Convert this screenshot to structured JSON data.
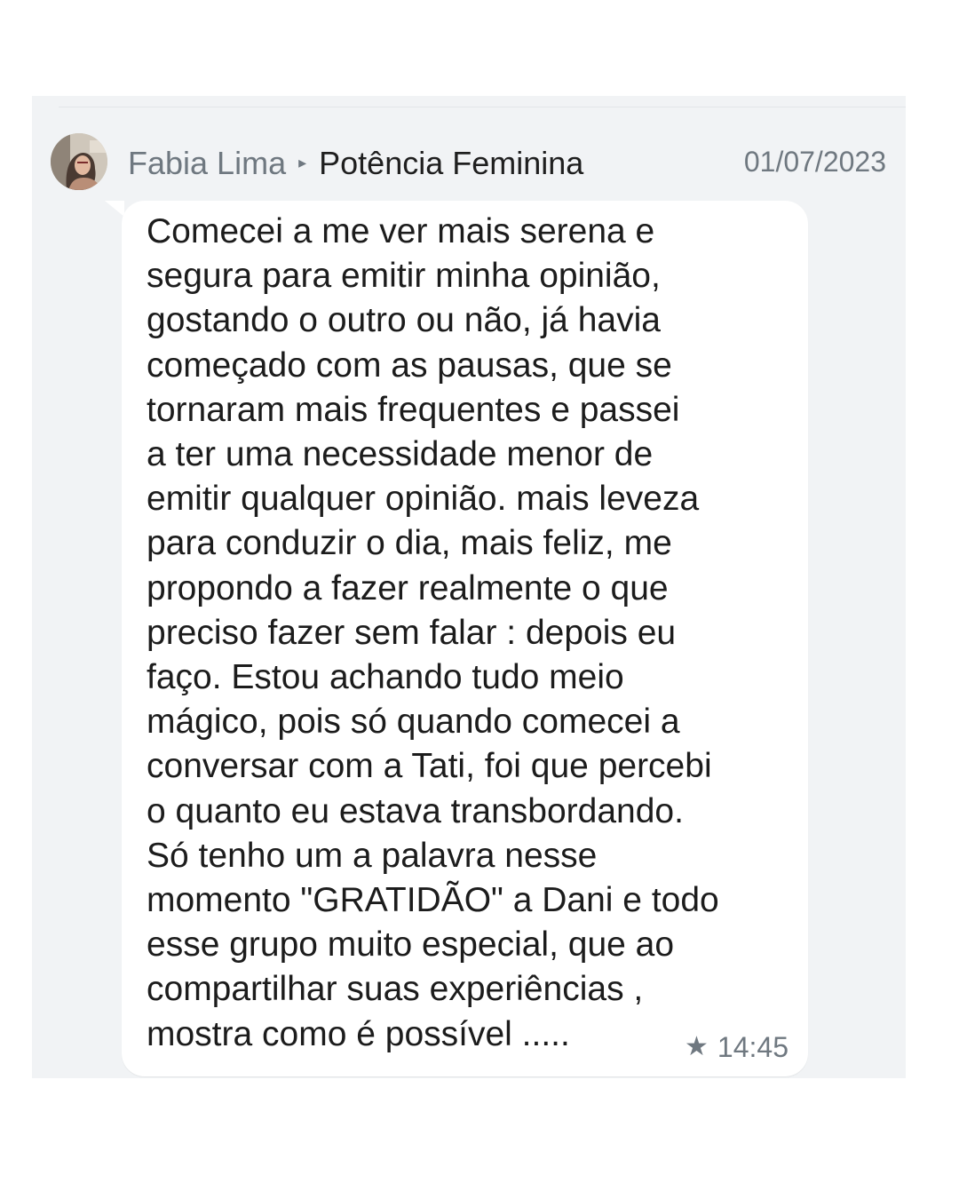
{
  "post": {
    "sender": "Fabia Lima",
    "separator_icon": "triangle-right-icon",
    "group": "Potência Feminina",
    "date": "01/07/2023",
    "avatar_icon": "user-photo-avatar"
  },
  "message": {
    "text": "Comecei a me ver mais serena e\nsegura para emitir minha opinião,\ngostando o outro ou não, já havia\ncomeçado com as pausas, que se\ntornaram mais frequentes e passei\na ter uma necessidade menor de\nemitir qualquer  opinião. mais leveza\npara conduzir o dia, mais feliz, me\npropondo a fazer realmente o que\npreciso fazer sem falar : depois eu\nfaço. Estou achando tudo meio\nmágico, pois só quando comecei a\nconversar com a Tati, foi que percebi\no quanto eu estava transbordando.\nSó tenho um a palavra nesse\nmomento \"GRATIDÃO\" a  Dani e todo\nesse grupo muito especial, que ao\ncompartilhar suas experiências ,\nmostra como é possível .....",
    "starred_icon": "star-icon",
    "time": "14:45"
  },
  "colors": {
    "panel_bg": "#f1f3f5",
    "bubble_bg": "#ffffff",
    "muted_text": "#6f7880",
    "body_text": "#1c1c1c"
  }
}
